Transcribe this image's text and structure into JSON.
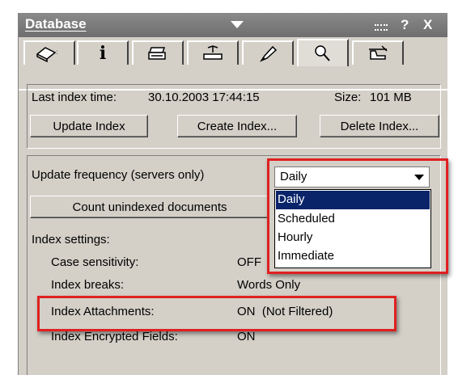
{
  "window": {
    "title": "Database",
    "help": "?",
    "close": "X"
  },
  "tabs": [
    {
      "icon": "database-icon"
    },
    {
      "icon": "info-icon"
    },
    {
      "icon": "printer-icon"
    },
    {
      "icon": "toolbox-icon"
    },
    {
      "icon": "pen-icon"
    },
    {
      "icon": "search-icon",
      "active": true
    },
    {
      "icon": "flask-icon"
    }
  ],
  "index": {
    "last_index_label": "Last index time:",
    "last_index_value": "30.10.2003 17:44:15",
    "size_label": "Size:",
    "size_value": "101 MB",
    "buttons": {
      "update": "Update Index",
      "create": "Create Index...",
      "delete": "Delete Index..."
    }
  },
  "settings": {
    "frequency_label": "Update frequency (servers only)",
    "frequency_value": "Daily",
    "frequency_options": [
      "Daily",
      "Scheduled",
      "Hourly",
      "Immediate"
    ],
    "count_button": "Count unindexed documents",
    "index_settings_label": "Index settings:",
    "rows": [
      {
        "label": "Case sensitivity:",
        "value": "OFF"
      },
      {
        "label": "Index breaks:",
        "value": "Words Only"
      },
      {
        "label": "Index Attachments:",
        "value": "ON  (Not Filtered)"
      },
      {
        "label": "Index Encrypted Fields:",
        "value": "ON"
      }
    ]
  },
  "colors": {
    "highlight_box": "#e02020",
    "selection": "#0a246a",
    "panel": "#d4d0c8"
  }
}
